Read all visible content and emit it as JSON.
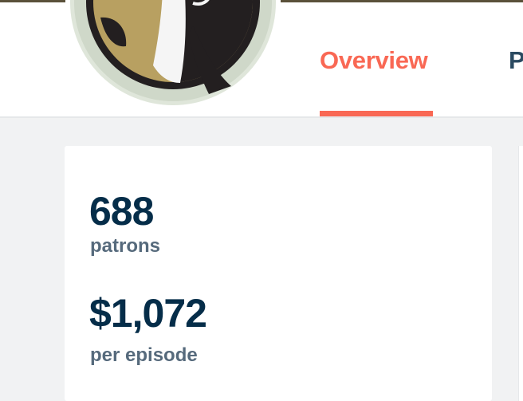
{
  "tabs": [
    {
      "label": "Overview",
      "active": true
    },
    {
      "label": "P",
      "active": false
    }
  ],
  "stats": {
    "patrons_count": "688",
    "patrons_label": "patrons",
    "earnings_amount": "$1,072",
    "earnings_label": "per episode"
  },
  "colors": {
    "accent": "#f96854",
    "heading": "#052d49",
    "muted": "#566a7c",
    "logo_gold": "#b8a061",
    "logo_dark": "#231f20"
  },
  "avatar": {
    "icon": "creator-logo-icon"
  }
}
